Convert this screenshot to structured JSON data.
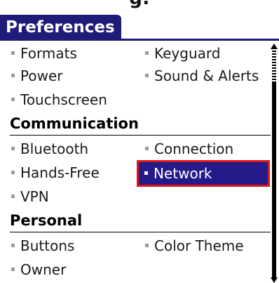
{
  "app": {
    "partial_title": "g."
  },
  "header": {
    "title": "Preferences"
  },
  "rows": {
    "general": [
      {
        "label": "Formats"
      },
      {
        "label": "Keyguard"
      },
      {
        "label": "Power"
      },
      {
        "label": "Sound & Alerts"
      },
      {
        "label": "Touchscreen"
      }
    ],
    "communication_title": "Communication",
    "communication": [
      {
        "label": "Bluetooth"
      },
      {
        "label": "Connection"
      },
      {
        "label": "Hands-Free"
      },
      {
        "label": "Network"
      },
      {
        "label": "VPN"
      }
    ],
    "personal_title": "Personal",
    "personal": [
      {
        "label": "Buttons"
      },
      {
        "label": "Color Theme"
      },
      {
        "label": "Owner"
      }
    ]
  },
  "colors": {
    "title_bg": "#1f1b78",
    "selected_bg": "#241a8a",
    "highlight_outline": "#e01515"
  },
  "icons": {
    "scroll_up": "scroll-up-arrow-icon",
    "scroll_down": "scroll-down-arrow-icon"
  }
}
